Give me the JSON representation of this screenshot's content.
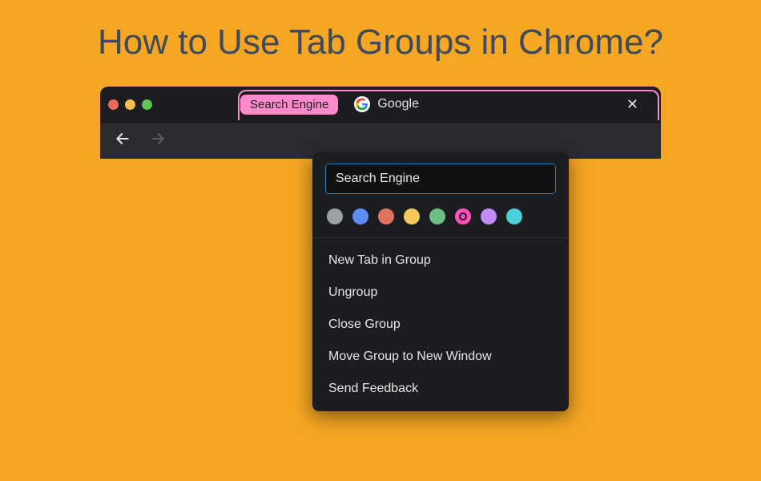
{
  "page_title": "How to Use Tab Groups in Chrome?",
  "traffic_lights": [
    "close",
    "minimize",
    "maximize"
  ],
  "tab_group": {
    "label": "Search Engine",
    "color": "#ff8acb"
  },
  "tab": {
    "title": "Google",
    "favicon": "google-icon"
  },
  "context_menu": {
    "input_value": "Search Engine",
    "colors": [
      {
        "name": "grey",
        "hex": "#9aa0a6",
        "selected": false
      },
      {
        "name": "blue",
        "hex": "#5e8df7",
        "selected": false
      },
      {
        "name": "red",
        "hex": "#e0745f",
        "selected": false
      },
      {
        "name": "yellow",
        "hex": "#f3c95b",
        "selected": false
      },
      {
        "name": "green",
        "hex": "#6bbf87",
        "selected": false
      },
      {
        "name": "pink",
        "hex": "#ff4fc3",
        "selected": true
      },
      {
        "name": "purple",
        "hex": "#c18cf9",
        "selected": false
      },
      {
        "name": "cyan",
        "hex": "#4dd0d9",
        "selected": false
      }
    ],
    "items": [
      "New Tab in Group",
      "Ungroup",
      "Close Group",
      "Move Group to New Window",
      "Send Feedback"
    ]
  }
}
